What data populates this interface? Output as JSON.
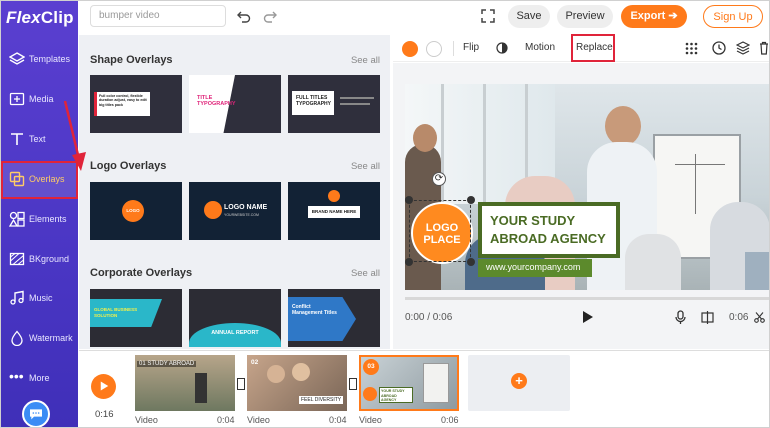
{
  "app": {
    "name_flex": "Flex",
    "name_clip": "Clip"
  },
  "sidebar": {
    "items": [
      {
        "label": "Templates"
      },
      {
        "label": "Media"
      },
      {
        "label": "Text"
      },
      {
        "label": "Overlays"
      },
      {
        "label": "Elements"
      },
      {
        "label": "BKground"
      },
      {
        "label": "Music"
      },
      {
        "label": "Watermark"
      },
      {
        "label": "More"
      }
    ]
  },
  "header": {
    "search_value": "bumper video",
    "save_label": "Save",
    "preview_label": "Preview",
    "export_label": "Export",
    "export_arrow": "➔",
    "signup_label": "Sign Up"
  },
  "panel": {
    "sections": [
      {
        "title": "Shape Overlays",
        "see_all": "See all"
      },
      {
        "title": "Logo Overlays",
        "see_all": "See all"
      },
      {
        "title": "Corporate Overlays",
        "see_all": "See all"
      }
    ],
    "shape_thumbs": [
      {
        "text": "Full color control, flexible duration adjust, easy to edit big titles pack"
      },
      {
        "text": "TITLE TYPOGRAPHY"
      },
      {
        "text": "FULL TITLES TYPOGRAPHY"
      }
    ],
    "logo_thumbs": [
      {
        "text": "LOGO"
      },
      {
        "text": "LOGO NAME",
        "sub": "YOURWEBSITE.COM"
      },
      {
        "text": "BRAND NAME HERE"
      }
    ],
    "corp_thumbs": [
      {
        "text": "GLOBAL BUSINESS SOLUTION"
      },
      {
        "text": "ANNUAL REPORT"
      },
      {
        "text": "Conflict Management Titles"
      }
    ]
  },
  "edit_toolbar": {
    "flip_label": "Flip",
    "motion_label": "Motion",
    "replace_label": "Replace"
  },
  "canvas": {
    "logo_text": "LOGO PLACE",
    "headline": "YOUR STUDY ABROAD AGENCY",
    "website": "www.yourcompany.com",
    "time_current": "0:00 / 0:06",
    "time_end": "0:06"
  },
  "timeline": {
    "total_time": "0:16",
    "clips": [
      {
        "index": "01",
        "caption": "STUDY ABROAD",
        "label": "Video",
        "duration": "0:04"
      },
      {
        "index": "02",
        "caption": "FEEL DIVERSITY",
        "label": "Video",
        "duration": "0:04"
      },
      {
        "index": "03",
        "caption": "YOUR STUDY ABROAD AGENCY",
        "label": "Video",
        "duration": "0:06"
      }
    ],
    "add_label": "+"
  },
  "colors": {
    "brand": "#5a3fd0",
    "accent": "#ff7a1a",
    "highlight": "#e0243a"
  }
}
